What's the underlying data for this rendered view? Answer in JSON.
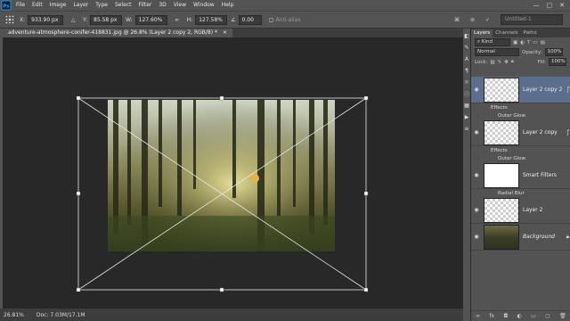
{
  "menubar": {
    "logo": "Ps",
    "items": [
      "File",
      "Edit",
      "Image",
      "Layer",
      "Type",
      "Select",
      "Filter",
      "3D",
      "View",
      "Window",
      "Help"
    ],
    "window_controls": [
      "—",
      "▢",
      "✕"
    ]
  },
  "options": {
    "x_label": "X:",
    "x_value": "933.90 px",
    "y_label": "Y:",
    "y_value": "85.58 px",
    "w_label": "W:",
    "w_value": "127.60%",
    "h_label": "H:",
    "h_value": "127.58%",
    "angle_label": "∠",
    "angle_value": "0.00",
    "antialias_label": "Anti-alias",
    "workspace": "Untitled-1"
  },
  "document": {
    "tab_title": "adventure-atmosphere-conifer-418831.jpg @ 26.8% (Layer 2 copy 2, RGB/8) *",
    "tab_close": "×"
  },
  "status": {
    "zoom": "26.81%",
    "doc": "Doc: 7.03M/17.1M"
  },
  "panel": {
    "tabs": [
      "Layers",
      "Channels",
      "Paths"
    ],
    "kind_label": "Kind",
    "blend_mode": "Normal",
    "opacity_label": "Opacity:",
    "opacity_value": "100%",
    "lock_label": "Lock:",
    "fill_label": "Fill:",
    "fill_value": "100%"
  },
  "layers": [
    {
      "name": "Layer 2 copy 2",
      "selected": true,
      "thumb": "checker",
      "effects": [
        "Effects",
        "Outer Glow"
      ]
    },
    {
      "name": "Layer 2 copy",
      "selected": false,
      "thumb": "checker",
      "effects": [
        "Effects",
        "Outer Glow"
      ]
    },
    {
      "name": "Smart Filters",
      "selected": false,
      "thumb": "white",
      "effects": [
        "Radial Blur"
      ]
    },
    {
      "name": "Layer 2",
      "selected": false,
      "thumb": "checker",
      "effects": []
    },
    {
      "name": "Background",
      "selected": false,
      "thumb": "forest",
      "effects": []
    }
  ],
  "panel_bottom_icons": [
    "link-icon",
    "fx-icon",
    "mask-icon",
    "adjustment-icon",
    "folder-icon",
    "new-layer-icon",
    "trash-icon"
  ],
  "colors": {
    "ui_gray": "#535353",
    "canvas_bg": "#282828",
    "selection_blue": "#5b6e8c"
  }
}
